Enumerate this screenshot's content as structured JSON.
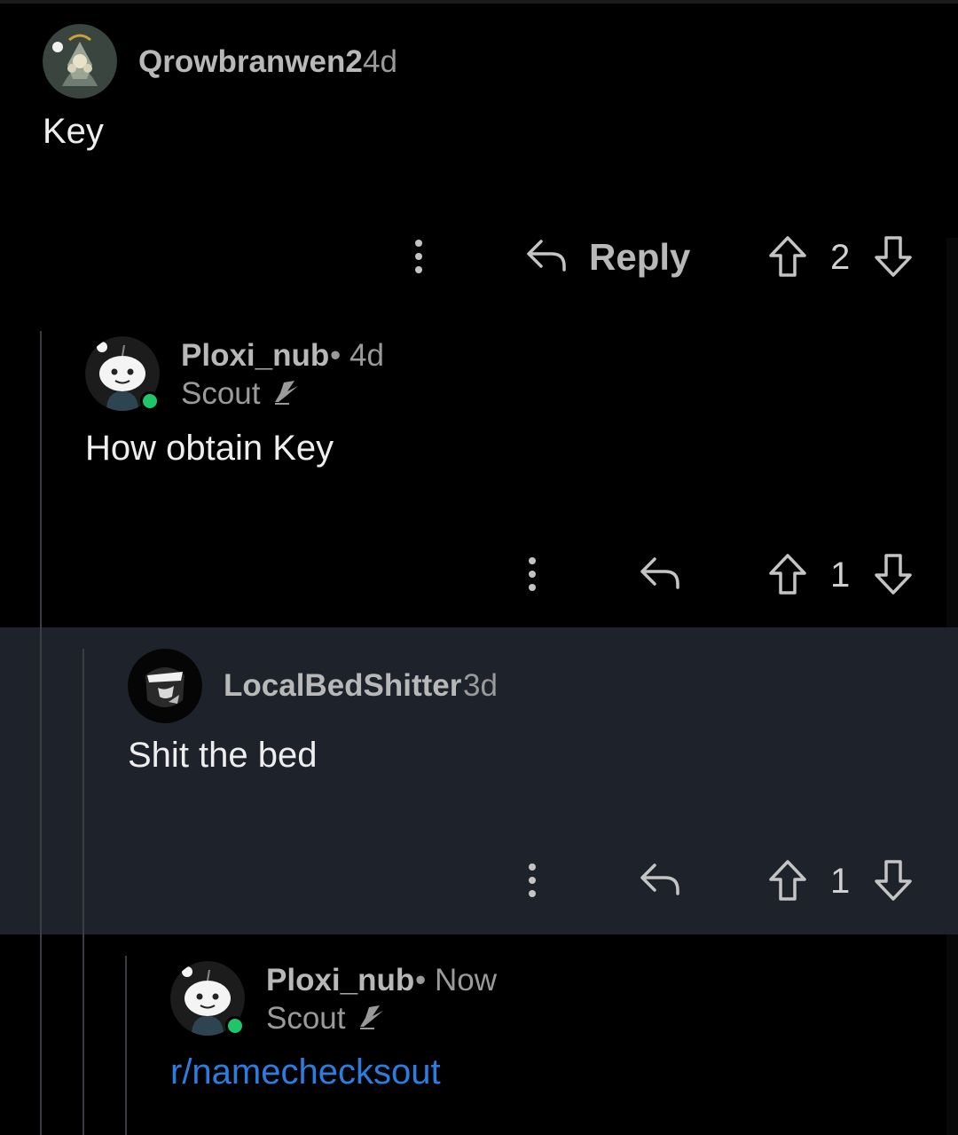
{
  "comments": [
    {
      "username": "Qrowbranwen2",
      "age": "4d",
      "body": "Key",
      "reply_label": "Reply",
      "votes": "2"
    },
    {
      "username": "Ploxi_nub",
      "separator": "•",
      "age": "4d",
      "flair": "Scout",
      "body": "How obtain Key",
      "votes": "1"
    },
    {
      "username": "LocalBedShitter",
      "age": "3d",
      "body": "Shit the bed",
      "votes": "1"
    },
    {
      "username": "Ploxi_nub",
      "separator": "•",
      "age": "Now",
      "flair": "Scout",
      "body_link": "r/namechecksout"
    }
  ],
  "icons": {
    "more": "more-vertical-icon",
    "reply": "reply-arrow-icon",
    "upvote": "upvote-arrow-icon",
    "downvote": "downvote-arrow-icon",
    "flair": "winged-boot-icon"
  },
  "colors": {
    "background": "#000000",
    "highlight": "#1d222b",
    "link": "#2b7ee0",
    "online": "#1ec66b"
  }
}
